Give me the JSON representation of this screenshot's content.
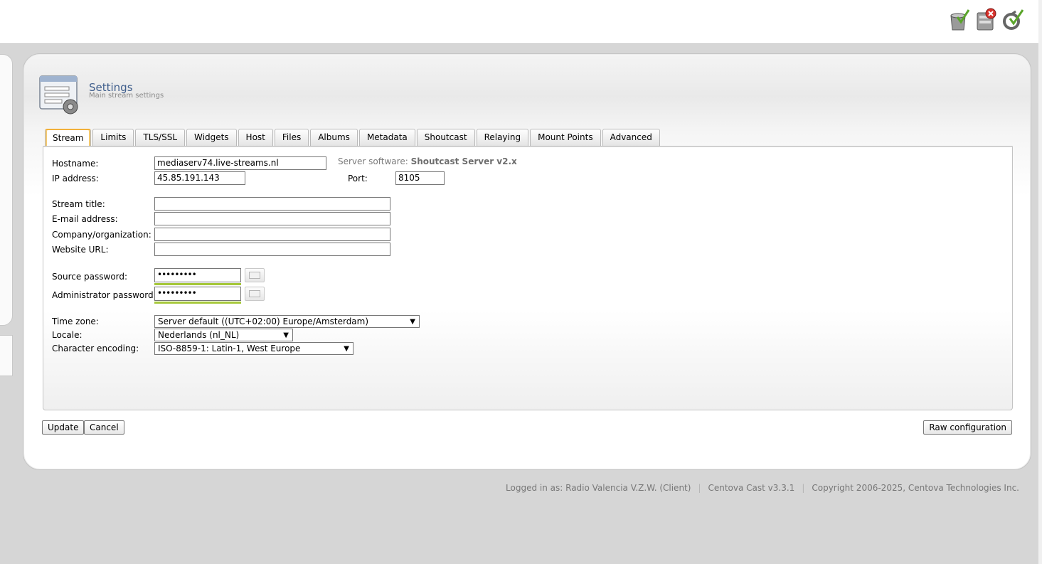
{
  "header": {
    "icons": [
      "server-ok-icon",
      "server-stop-icon",
      "server-restart-icon"
    ]
  },
  "page": {
    "title": "Settings",
    "subtitle": "Main stream settings"
  },
  "tabs": [
    {
      "label": "Stream",
      "active": true
    },
    {
      "label": "Limits"
    },
    {
      "label": "TLS/SSL"
    },
    {
      "label": "Widgets"
    },
    {
      "label": "Host"
    },
    {
      "label": "Files"
    },
    {
      "label": "Albums"
    },
    {
      "label": "Metadata"
    },
    {
      "label": "Shoutcast"
    },
    {
      "label": "Relaying"
    },
    {
      "label": "Mount Points"
    },
    {
      "label": "Advanced"
    }
  ],
  "form": {
    "hostname_label": "Hostname:",
    "hostname_value": "mediaserv74.live-streams.nl",
    "server_software_label": "Server software:",
    "server_software_value": "Shoutcast Server v2.x",
    "ip_label": "IP address:",
    "ip_value": "45.85.191.143",
    "port_label": "Port:",
    "port_value": "8105",
    "stream_title_label": "Stream title:",
    "stream_title_value": "",
    "email_label": "E-mail address:",
    "email_value": "",
    "company_label": "Company/organization:",
    "company_value": "",
    "website_label": "Website URL:",
    "website_value": "",
    "source_pw_label": "Source password:",
    "source_pw_value": "•••••••••",
    "admin_pw_label": "Administrator password:",
    "admin_pw_value": "•••••••••",
    "timezone_label": "Time zone:",
    "timezone_value": "Server default ((UTC+02:00) Europe/Amsterdam)",
    "locale_label": "Locale:",
    "locale_value": "Nederlands (nl_NL)",
    "encoding_label": "Character encoding:",
    "encoding_value": "ISO-8859-1: Latin-1, West Europe"
  },
  "actions": {
    "update": "Update",
    "cancel": "Cancel",
    "raw_config": "Raw configuration"
  },
  "footer": {
    "logged_in": "Logged in as: Radio Valencia V.Z.W. (Client)",
    "version": "Centova Cast v3.3.1",
    "copyright": "Copyright 2006-2025, Centova Technologies Inc."
  },
  "colors": {
    "accent_tab": "#f2b13a",
    "password_strength": "#a6c83a",
    "title": "#3f5e8c"
  }
}
